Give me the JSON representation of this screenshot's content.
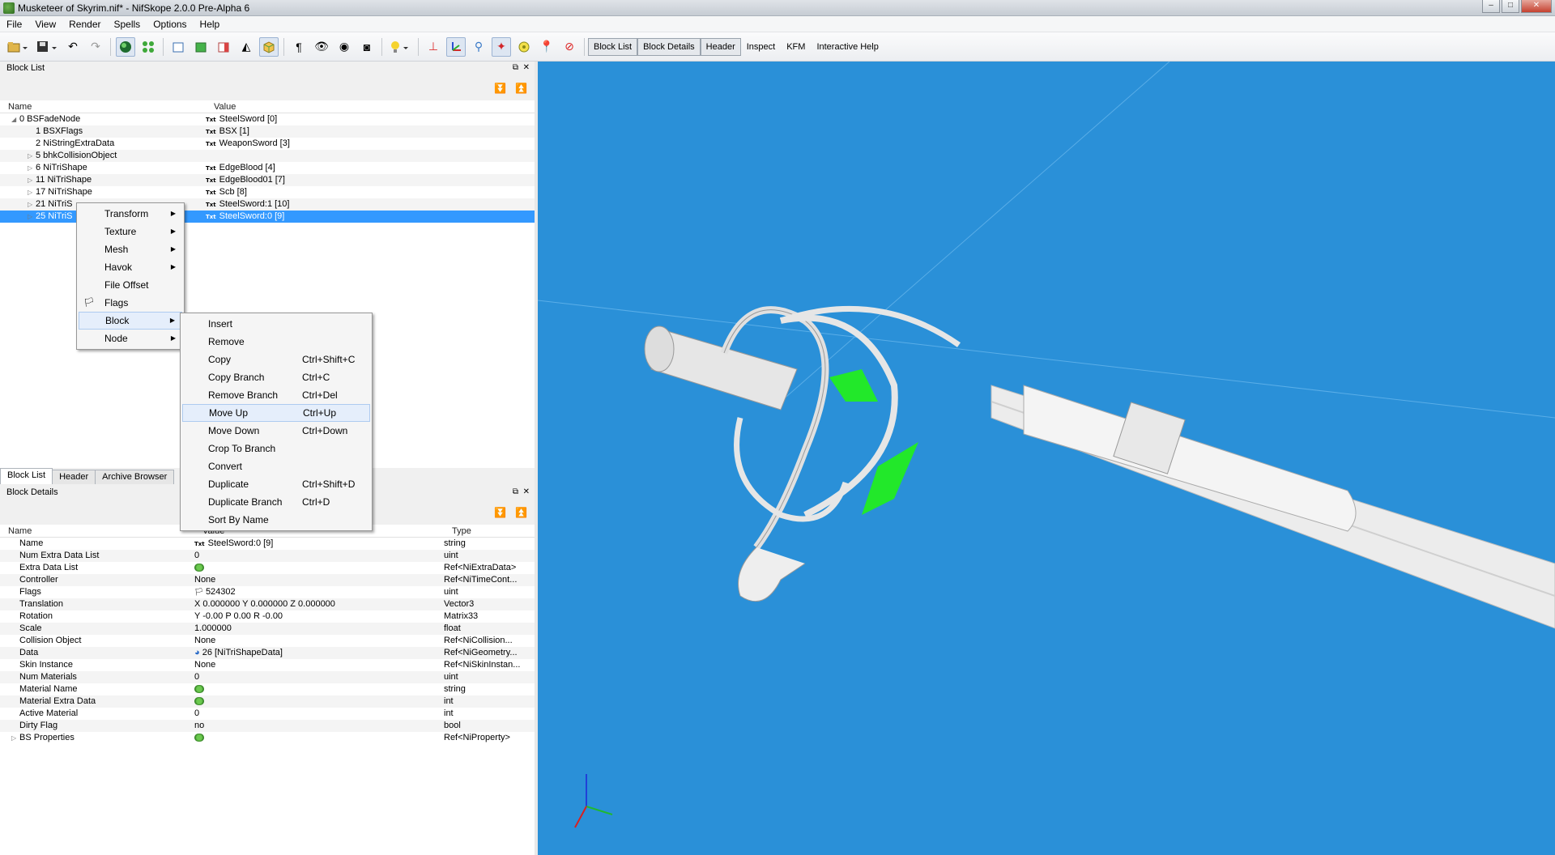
{
  "window": {
    "title": "Musketeer of Skyrim.nif* - NifSkope 2.0.0 Pre-Alpha 6",
    "min": "–",
    "max": "□",
    "close": "✕"
  },
  "menubar": [
    "File",
    "View",
    "Render",
    "Spells",
    "Options",
    "Help"
  ],
  "toolbar": {
    "text_buttons": [
      "Block List",
      "Block Details",
      "Header",
      "Inspect",
      "KFM",
      "Interactive Help"
    ]
  },
  "block_list": {
    "title": "Block List",
    "float_icon": "⧉",
    "close_icon": "✕",
    "col_name": "Name",
    "col_value": "Value",
    "rows": [
      {
        "name": "0 BSFadeNode",
        "value": "SteelSword [0]",
        "arrow": "◢",
        "indent": 0
      },
      {
        "name": "1 BSXFlags",
        "value": "BSX [1]",
        "arrow": "",
        "indent": 1
      },
      {
        "name": "2 NiStringExtraData",
        "value": "WeaponSword [3]",
        "arrow": "",
        "indent": 1
      },
      {
        "name": "5 bhkCollisionObject",
        "value": "",
        "arrow": "▷",
        "indent": 1
      },
      {
        "name": "6 NiTriShape",
        "value": "EdgeBlood [4]",
        "arrow": "▷",
        "indent": 1
      },
      {
        "name": "11 NiTriShape",
        "value": "EdgeBlood01 [7]",
        "arrow": "▷",
        "indent": 1
      },
      {
        "name": "17 NiTriShape",
        "value": "Scb [8]",
        "arrow": "▷",
        "indent": 1
      },
      {
        "name": "21 NiTriS",
        "value": "SteelSword:1 [10]",
        "arrow": "▷",
        "indent": 1
      },
      {
        "name": "25 NiTriS",
        "value": "SteelSword:0 [9]",
        "arrow": "▷",
        "indent": 1,
        "selected": true
      }
    ],
    "txt_icon": "Txt"
  },
  "bottom_tabs": [
    "Block List",
    "Header",
    "Archive Browser"
  ],
  "block_details": {
    "title": "Block Details",
    "col_name": "Name",
    "col_value": "Value",
    "col_type": "Type",
    "rows": [
      {
        "name": "Name",
        "value": "SteelSword:0 [9]",
        "type": "string",
        "icon": "txt"
      },
      {
        "name": "Num Extra Data List",
        "value": "0",
        "type": "uint"
      },
      {
        "name": "Extra Data List",
        "value": "",
        "type": "Ref<NiExtraData>",
        "icon": "grn"
      },
      {
        "name": "Controller",
        "value": "None",
        "type": "Ref<NiTimeCont..."
      },
      {
        "name": "Flags",
        "value": "524302",
        "type": "uint",
        "icon": "flag"
      },
      {
        "name": "Translation",
        "value": "X 0.000000 Y 0.000000 Z 0.000000",
        "type": "Vector3"
      },
      {
        "name": "Rotation",
        "value": "Y -0.00 P 0.00 R -0.00",
        "type": "Matrix33"
      },
      {
        "name": "Scale",
        "value": "1.000000",
        "type": "float"
      },
      {
        "name": "Collision Object",
        "value": "None",
        "type": "Ref<NiCollision..."
      },
      {
        "name": "Data",
        "value": "26 [NiTriShapeData]",
        "type": "Ref<NiGeometry...",
        "icon": "globe"
      },
      {
        "name": "Skin Instance",
        "value": "None",
        "type": "Ref<NiSkinInstan..."
      },
      {
        "name": "Num Materials",
        "value": "0",
        "type": "uint"
      },
      {
        "name": "Material Name",
        "value": "",
        "type": "string",
        "icon": "grn"
      },
      {
        "name": "Material Extra Data",
        "value": "",
        "type": "int",
        "icon": "grn"
      },
      {
        "name": "Active Material",
        "value": "0",
        "type": "int"
      },
      {
        "name": "Dirty Flag",
        "value": "no",
        "type": "bool"
      },
      {
        "name": "BS Properties",
        "value": "",
        "type": "Ref<NiProperty>",
        "icon": "grn",
        "arrow": "▷"
      }
    ]
  },
  "context_menu": {
    "items": [
      {
        "label": "Transform",
        "sub": "▶"
      },
      {
        "label": "Texture",
        "sub": "▶"
      },
      {
        "label": "Mesh",
        "sub": "▶"
      },
      {
        "label": "Havok",
        "sub": "▶"
      },
      {
        "label": "File Offset",
        "sub": ""
      },
      {
        "label": "Flags",
        "sub": "",
        "icon": "🏳"
      },
      {
        "label": "Block",
        "sub": "▶",
        "hot": true
      },
      {
        "label": "Node",
        "sub": "▶"
      }
    ]
  },
  "block_submenu": {
    "items": [
      {
        "label": "Insert",
        "shortcut": ""
      },
      {
        "label": "Remove",
        "shortcut": ""
      },
      {
        "label": "Copy",
        "shortcut": "Ctrl+Shift+C"
      },
      {
        "label": "Copy Branch",
        "shortcut": "Ctrl+C"
      },
      {
        "label": "Remove Branch",
        "shortcut": "Ctrl+Del"
      },
      {
        "label": "Move Up",
        "shortcut": "Ctrl+Up",
        "hot": true
      },
      {
        "label": "Move Down",
        "shortcut": "Ctrl+Down"
      },
      {
        "label": "Crop To Branch",
        "shortcut": ""
      },
      {
        "label": "Convert",
        "shortcut": ""
      },
      {
        "label": "Duplicate",
        "shortcut": "Ctrl+Shift+D"
      },
      {
        "label": "Duplicate Branch",
        "shortcut": "Ctrl+D"
      },
      {
        "label": "Sort By Name",
        "shortcut": ""
      }
    ]
  },
  "colors": {
    "viewport_bg": "#2a90d8",
    "selection": "#3399ff",
    "highlight_green": "#22e82a"
  }
}
